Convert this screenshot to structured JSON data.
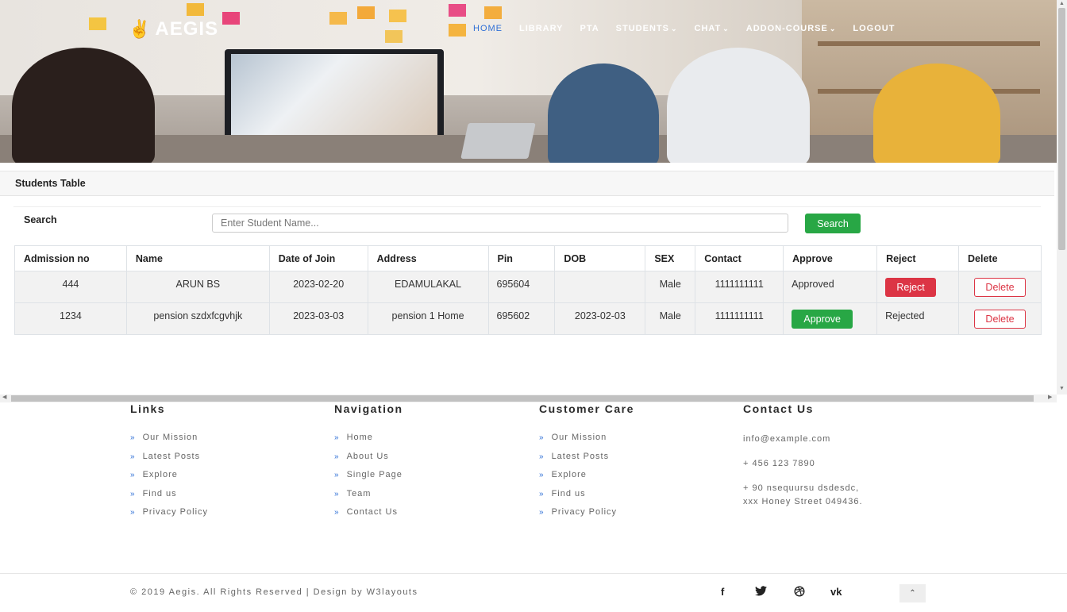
{
  "brand": {
    "logo_icon": "✌",
    "name": "AEGIS"
  },
  "nav": {
    "items": [
      {
        "label": "HOME",
        "active": true,
        "dropdown": false
      },
      {
        "label": "LIBRARY",
        "active": false,
        "dropdown": false
      },
      {
        "label": "PTA",
        "active": false,
        "dropdown": false
      },
      {
        "label": "STUDENTS",
        "active": false,
        "dropdown": true
      },
      {
        "label": "CHAT",
        "active": false,
        "dropdown": true
      },
      {
        "label": "ADDON-COURSE",
        "active": false,
        "dropdown": true
      },
      {
        "label": "LOGOUT",
        "active": false,
        "dropdown": false
      }
    ],
    "caret": "⌄"
  },
  "panel": {
    "title": "Students Table",
    "search_label": "Search",
    "search_placeholder": "Enter Student Name...",
    "search_button": "Search"
  },
  "table": {
    "columns": [
      "Admission no",
      "Name",
      "Date of Join",
      "Address",
      "Pin",
      "DOB",
      "SEX",
      "Contact",
      "Approve",
      "Reject",
      "Delete"
    ],
    "rows": [
      {
        "admission_no": "444",
        "name": "ARUN BS",
        "date_of_join": "2023-02-20",
        "address": "EDAMULAKAL",
        "pin": "695604",
        "dob": "",
        "sex": "Male",
        "contact": "1111111111",
        "approve": "Approved",
        "reject": "Reject",
        "delete": "Delete"
      },
      {
        "admission_no": "1234",
        "name": "pension szdxfcgvhjk",
        "date_of_join": "2023-03-03",
        "address": "pension 1 Home",
        "pin": "695602",
        "dob": "2023-02-03",
        "sex": "Male",
        "contact": "1111111111",
        "approve": "Approve",
        "reject": "Rejected",
        "delete": "Delete"
      }
    ]
  },
  "footer": {
    "links": {
      "title": "Links",
      "items": [
        "Our Mission",
        "Latest Posts",
        "Explore",
        "Find us",
        "Privacy Policy"
      ]
    },
    "navigation": {
      "title": "Navigation",
      "items": [
        "Home",
        "About Us",
        "Single Page",
        "Team",
        "Contact Us"
      ]
    },
    "customer_care": {
      "title": "Customer Care",
      "items": [
        "Our Mission",
        "Latest Posts",
        "Explore",
        "Find us",
        "Privacy Policy"
      ]
    },
    "contact": {
      "title": "Contact Us",
      "email": "info@example.com",
      "phone": "+ 456 123 7890",
      "address_line1": "+ 90 nsequursu dsdesdc,",
      "address_line2": "xxx Honey Street 049436."
    },
    "chevron": "»",
    "copyright": "© 2019 Aegis. All Rights Reserved | Design by W3layouts",
    "social": [
      {
        "icon": "facebook-icon",
        "glyph": "f"
      },
      {
        "icon": "twitter-icon",
        "glyph": "🐦"
      },
      {
        "icon": "dribbble-icon",
        "glyph": "⊛"
      },
      {
        "icon": "vk-icon",
        "glyph": "vk"
      }
    ],
    "to_top": "⌃"
  },
  "colors": {
    "accent_blue": "#2f6fd6",
    "success": "#28a745",
    "danger": "#dc3545"
  }
}
